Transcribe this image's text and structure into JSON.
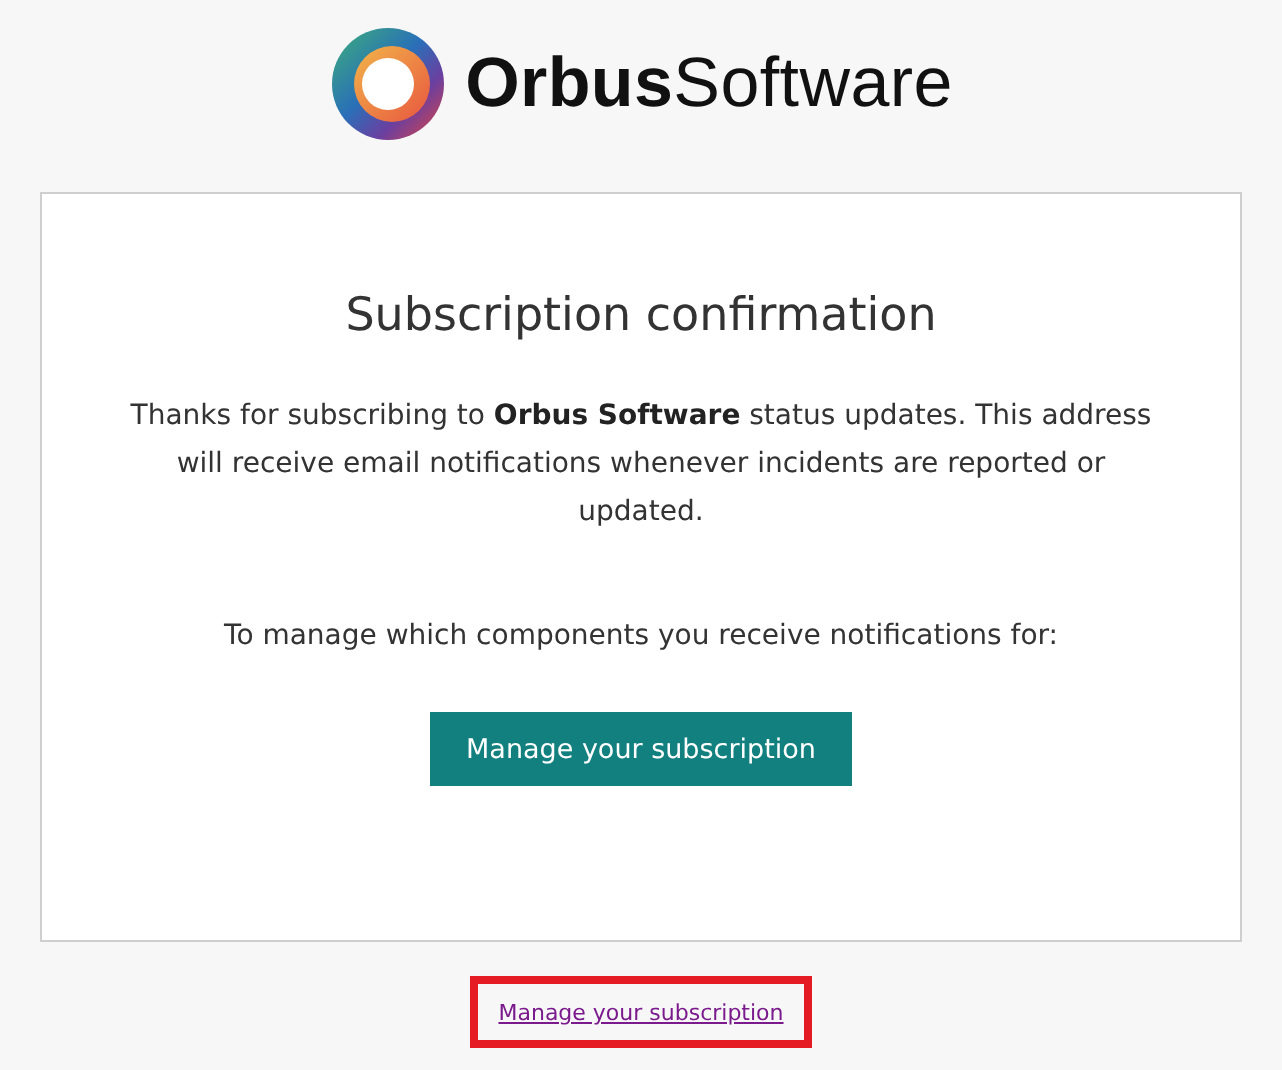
{
  "logo": {
    "text": "**Orbus**Software"
  },
  "card": {
    "title": "Subscription confirmation",
    "message": "Thanks for subscribing to **Orbus Software** status updates. This address will receive email notifications whenever incidents are reported or updated.",
    "prompt": "To manage which components you receive notifications for:",
    "button": "Manage your subscription"
  },
  "footer_link": {
    "text": "Manage your subscription",
    "highlighted": true
  }
}
